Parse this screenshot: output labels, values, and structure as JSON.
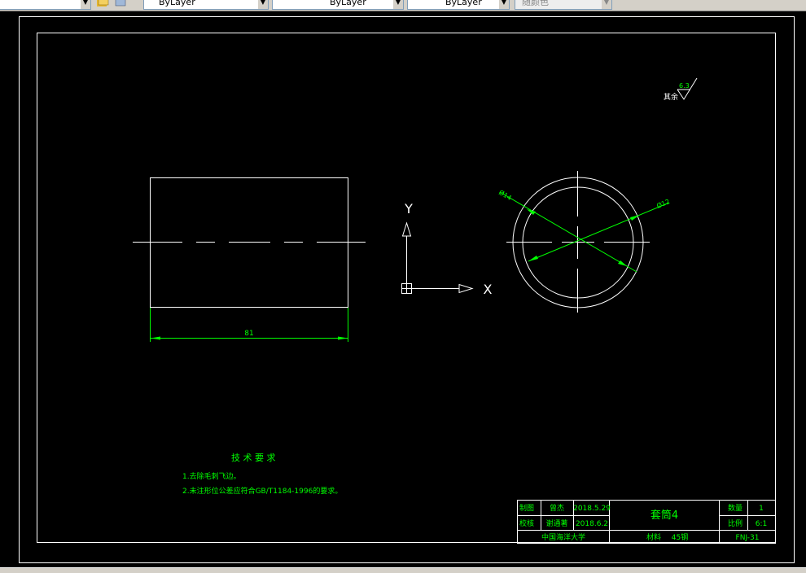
{
  "toolbar": {
    "layer_color": "ByLayer",
    "linetype": "ByLayer",
    "lineweight": "ByLayer",
    "plot_style": "随颜色"
  },
  "ucs": {
    "x_label": "X",
    "y_label": "Y"
  },
  "drawing": {
    "dim_length": "81",
    "dim_inner_dia": "Ø14",
    "dim_outer_dia": "Ø12",
    "roughness_value": "6.3",
    "roughness_prefix": "其余"
  },
  "tech": {
    "heading": "技 术 要 求",
    "item1": "1.去除毛刺飞边。",
    "item2": "2.未注形位公差应符合GB/T1184-1996的要求。"
  },
  "title_block": {
    "drawn_label": "制图",
    "drawn_name": "曾杰",
    "drawn_date": "2018.5.29",
    "check_label": "校核",
    "check_name": "谢通著",
    "check_date": "2018.6.2",
    "part_name": "套筒4",
    "qty_label": "数量",
    "qty_value": "1",
    "scale_label": "比例",
    "scale_value": "6:1",
    "school": "中国海洋大学",
    "material_label": "材料",
    "material_value": "45钢",
    "drawing_no": "FNJ-31"
  },
  "colors": {
    "drawing": "#ffffff",
    "annotation": "#00ff00",
    "background": "#000000"
  }
}
